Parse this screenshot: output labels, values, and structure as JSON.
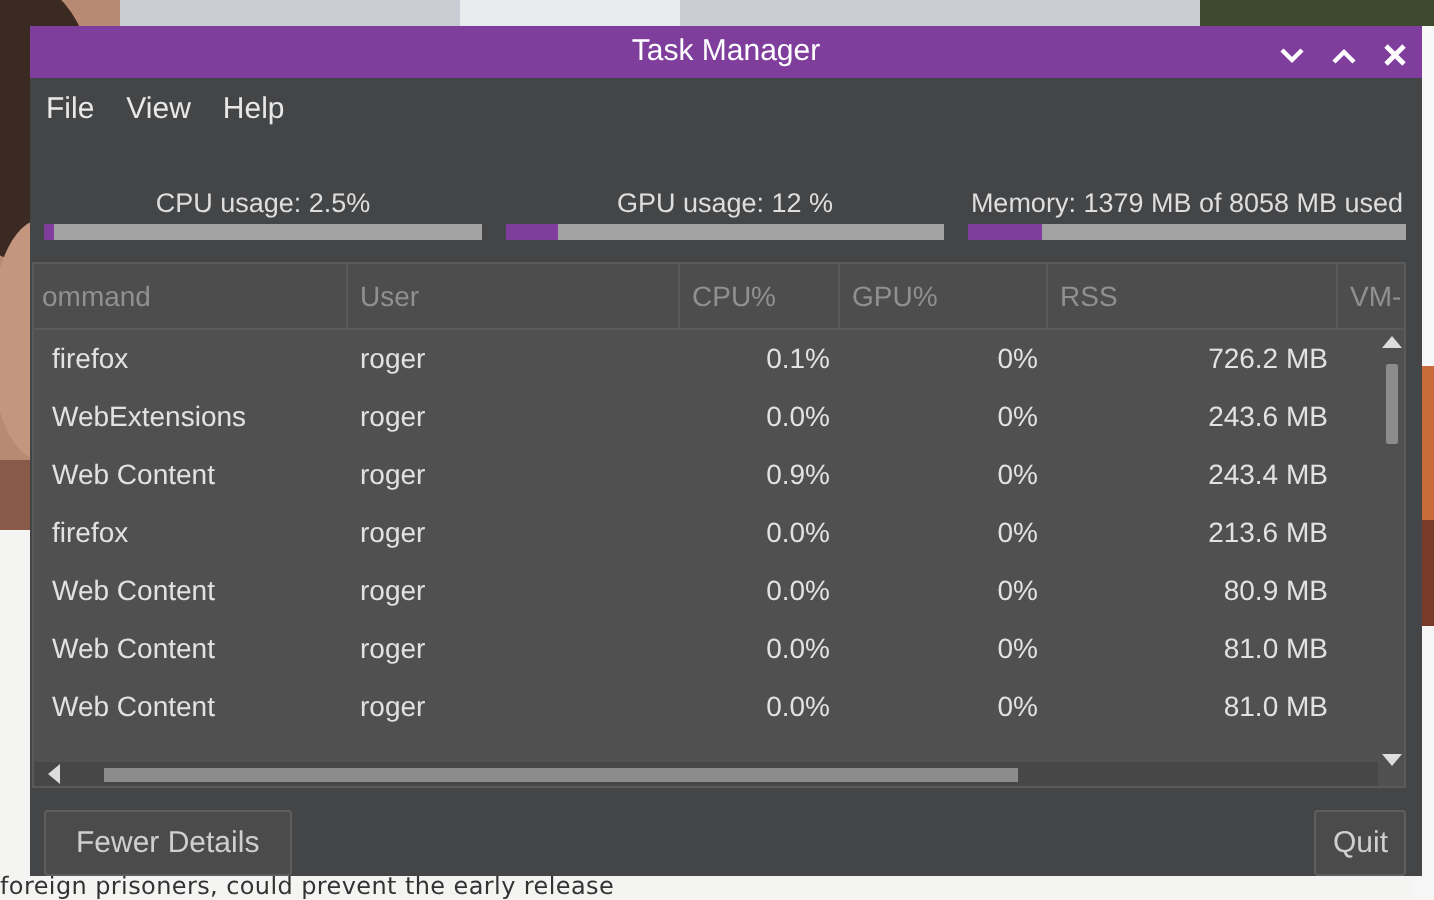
{
  "background": {
    "kind": "picture",
    "caption": "foreign prisoners, could prevent the early release"
  },
  "window": {
    "title": "Task Manager"
  },
  "menu": [
    "File",
    "View",
    "Help"
  ],
  "meters": [
    {
      "label": "CPU usage: 2.5%",
      "level": 0.025
    },
    {
      "label": "GPU usage: 12 %",
      "level": 0.12
    },
    {
      "label": "Memory: 1379 MB of 8058 MB used",
      "level": 0.17
    }
  ],
  "table": {
    "columns": [
      "ommand",
      "User",
      "CPU%",
      "GPU%",
      "RSS",
      "VM-"
    ],
    "rows": [
      [
        "firefox",
        "roger",
        "0.1%",
        "0%",
        "726.2 MB"
      ],
      [
        "WebExtensions",
        "roger",
        "0.0%",
        "0%",
        "243.6 MB"
      ],
      [
        "Web Content",
        "roger",
        "0.9%",
        "0%",
        "243.4 MB"
      ],
      [
        "firefox",
        "roger",
        "0.0%",
        "0%",
        "213.6 MB"
      ],
      [
        "Web Content",
        "roger",
        "0.0%",
        "0%",
        "80.9 MB"
      ],
      [
        "Web Content",
        "roger",
        "0.0%",
        "0%",
        "81.0 MB"
      ],
      [
        "Web Content",
        "roger",
        "0.0%",
        "0%",
        "81.0 MB"
      ]
    ]
  },
  "buttons": [
    "Fewer Details",
    "Quit"
  ]
}
